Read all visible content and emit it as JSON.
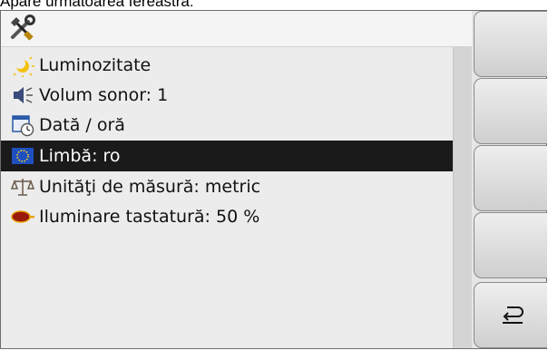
{
  "caption": "Apare următoarea fereastră:",
  "header": {
    "icon": "tools-icon"
  },
  "menu": [
    {
      "label": "Luminozitate",
      "icon": "brightness-icon",
      "selected": false
    },
    {
      "label": "Volum sonor: 1",
      "icon": "volume-icon",
      "selected": false
    },
    {
      "label": "Dată / oră",
      "icon": "calendar-clock-icon",
      "selected": false
    },
    {
      "label": "Limbă: ro",
      "icon": "eu-flag-icon",
      "selected": true
    },
    {
      "label": "Unităţi de măsură: metric",
      "icon": "scales-icon",
      "selected": false
    },
    {
      "label": "Iluminare tastatură:  50 %",
      "icon": "keyboard-light-icon",
      "selected": false
    }
  ],
  "softkeys": [
    {
      "icon": ""
    },
    {
      "icon": ""
    },
    {
      "icon": ""
    },
    {
      "icon": ""
    },
    {
      "icon": "back-icon"
    }
  ]
}
